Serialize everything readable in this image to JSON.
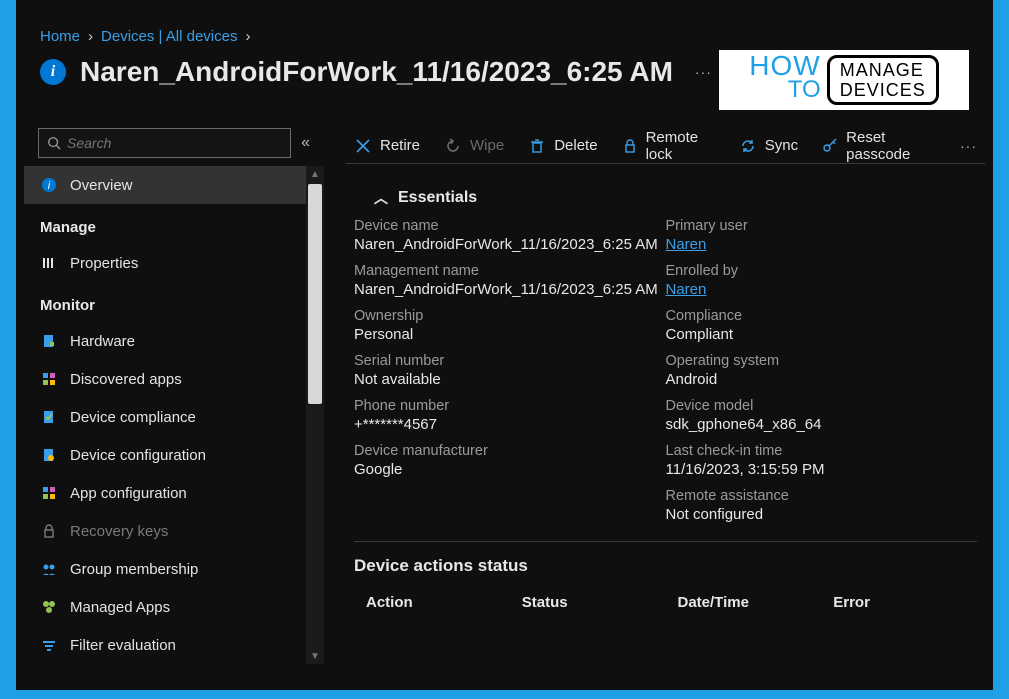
{
  "breadcrumb": [
    {
      "text": "Home"
    },
    {
      "text": "Devices | All devices"
    }
  ],
  "title": "Naren_AndroidForWork_11/16/2023_6:25 AM",
  "logo": {
    "line1": "HOW",
    "line2": "TO",
    "box_line1": "MANAGE",
    "box_line2": "DEVICES"
  },
  "search": {
    "placeholder": "Search"
  },
  "sidebar": {
    "items": [
      {
        "type": "item",
        "label": "Overview",
        "active": true
      },
      {
        "type": "section",
        "label": "Manage"
      },
      {
        "type": "item",
        "label": "Properties"
      },
      {
        "type": "section",
        "label": "Monitor"
      },
      {
        "type": "item",
        "label": "Hardware"
      },
      {
        "type": "item",
        "label": "Discovered apps"
      },
      {
        "type": "item",
        "label": "Device compliance"
      },
      {
        "type": "item",
        "label": "Device configuration"
      },
      {
        "type": "item",
        "label": "App configuration"
      },
      {
        "type": "item",
        "label": "Recovery keys",
        "disabled": true
      },
      {
        "type": "item",
        "label": "Group membership"
      },
      {
        "type": "item",
        "label": "Managed Apps"
      },
      {
        "type": "item",
        "label": "Filter evaluation"
      }
    ]
  },
  "toolbar": {
    "retire": "Retire",
    "wipe": "Wipe",
    "delete": "Delete",
    "remote_lock": "Remote lock",
    "sync": "Sync",
    "reset_passcode": "Reset passcode"
  },
  "essentials": {
    "header": "Essentials",
    "left": [
      {
        "label": "Device name",
        "value": "Naren_AndroidForWork_11/16/2023_6:25 AM"
      },
      {
        "label": "Management name",
        "value": "Naren_AndroidForWork_11/16/2023_6:25 AM"
      },
      {
        "label": "Ownership",
        "value": "Personal"
      },
      {
        "label": "Serial number",
        "value": "Not available"
      },
      {
        "label": "Phone number",
        "value": "+*******4567"
      },
      {
        "label": "Device manufacturer",
        "value": "Google"
      }
    ],
    "right": [
      {
        "label": "Primary user",
        "value": "Naren",
        "link": true
      },
      {
        "label": "Enrolled by",
        "value": "Naren",
        "link": true
      },
      {
        "label": "Compliance",
        "value": "Compliant"
      },
      {
        "label": "Operating system",
        "value": "Android"
      },
      {
        "label": "Device model",
        "value": "sdk_gphone64_x86_64"
      },
      {
        "label": "Last check-in time",
        "value": "11/16/2023, 3:15:59 PM"
      },
      {
        "label": "Remote assistance",
        "value": "Not configured"
      }
    ]
  },
  "actions_status": {
    "title": "Device actions status",
    "columns": [
      "Action",
      "Status",
      "Date/Time",
      "Error"
    ]
  }
}
